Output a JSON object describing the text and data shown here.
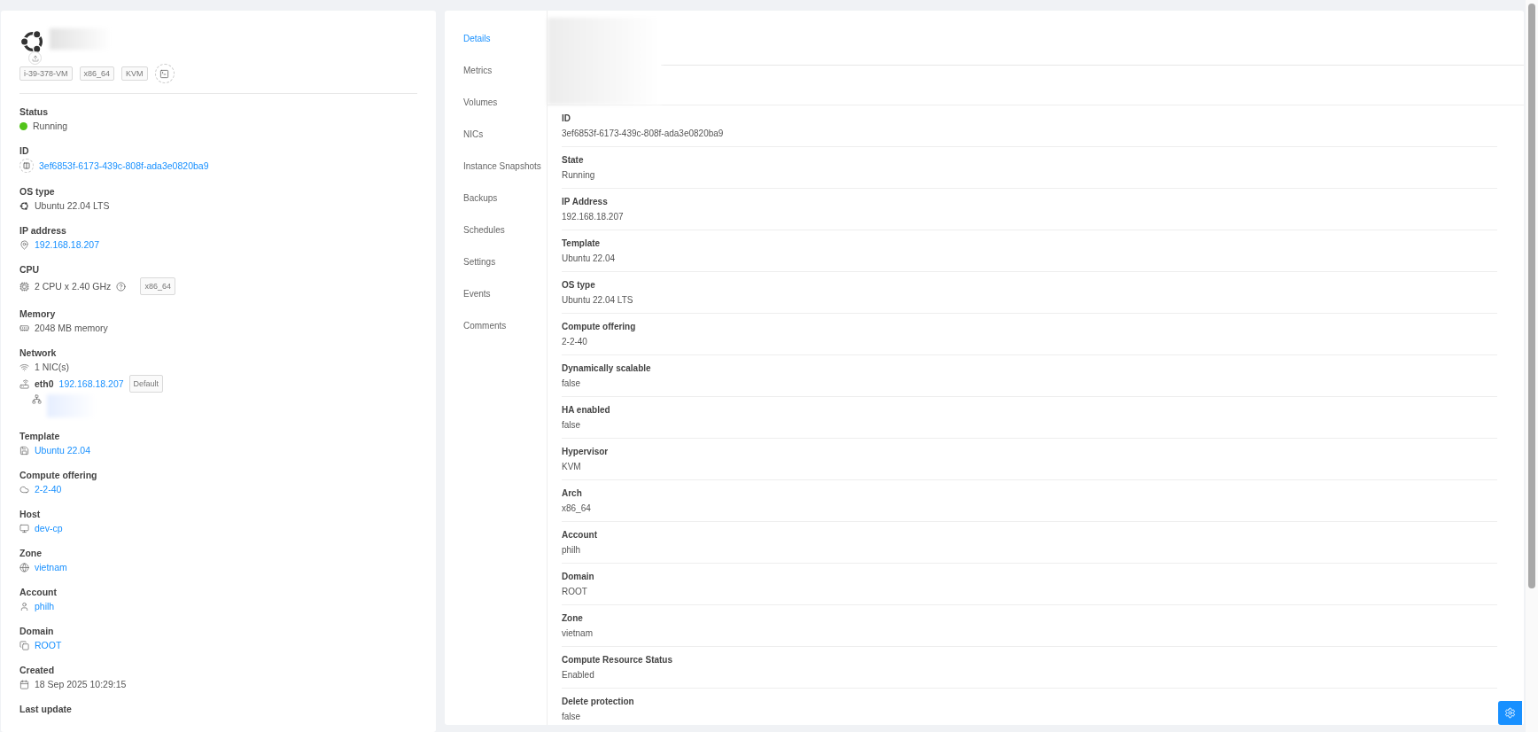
{
  "instance": {
    "tags": [
      "i-39-378-VM",
      "x86_64",
      "KVM"
    ]
  },
  "info": [
    {
      "kind": "status",
      "label": "Status",
      "value": "Running",
      "color": "#52c41a"
    },
    {
      "kind": "link",
      "label": "ID",
      "value": "3ef6853f-6173-439c-808f-ada3e0820ba9"
    },
    {
      "kind": "text",
      "label": "OS type",
      "value": "Ubuntu 22.04 LTS"
    },
    {
      "kind": "link",
      "label": "IP address",
      "value": "192.168.18.207"
    },
    {
      "kind": "cpu",
      "label": "CPU",
      "value": "2 CPU x 2.40 GHz",
      "tag": "x86_64"
    },
    {
      "kind": "text",
      "label": "Memory",
      "value": "2048 MB memory"
    },
    {
      "kind": "network",
      "label": "Network",
      "value": "1 NIC(s)",
      "nics": [
        {
          "name": "eth0",
          "ip": "192.168.18.207",
          "badge": "Default"
        }
      ]
    },
    {
      "kind": "link",
      "label": "Template",
      "value": "Ubuntu 22.04"
    },
    {
      "kind": "link",
      "label": "Compute offering",
      "value": "2-2-40"
    },
    {
      "kind": "link",
      "label": "Host",
      "value": "dev-cp"
    },
    {
      "kind": "link",
      "label": "Zone",
      "value": "vietnam"
    },
    {
      "kind": "link",
      "label": "Account",
      "value": "philh"
    },
    {
      "kind": "link",
      "label": "Domain",
      "value": "ROOT"
    },
    {
      "kind": "text",
      "label": "Created",
      "value": "18 Sep 2025 10:29:15"
    },
    {
      "kind": "heading",
      "label": "Last update"
    }
  ],
  "tabs": [
    {
      "label": "Details",
      "selected": true
    },
    {
      "label": "Metrics",
      "selected": false
    },
    {
      "label": "Volumes",
      "selected": false
    },
    {
      "label": "NICs",
      "selected": false
    },
    {
      "label": "Instance Snapshots",
      "selected": false
    },
    {
      "label": "Backups",
      "selected": false
    },
    {
      "label": "Schedules",
      "selected": false
    },
    {
      "label": "Settings",
      "selected": false
    },
    {
      "label": "Events",
      "selected": false
    },
    {
      "label": "Comments",
      "selected": false
    }
  ],
  "details": [
    {
      "label": "ID",
      "value": "3ef6853f-6173-439c-808f-ada3e0820ba9"
    },
    {
      "label": "State",
      "value": "Running"
    },
    {
      "label": "IP Address",
      "value": "192.168.18.207"
    },
    {
      "label": "Template",
      "value": "Ubuntu 22.04"
    },
    {
      "label": "OS type",
      "value": "Ubuntu 22.04 LTS"
    },
    {
      "label": "Compute offering",
      "value": "2-2-40"
    },
    {
      "label": "Dynamically scalable",
      "value": "false"
    },
    {
      "label": "HA enabled",
      "value": "false"
    },
    {
      "label": "Hypervisor",
      "value": "KVM"
    },
    {
      "label": "Arch",
      "value": "x86_64"
    },
    {
      "label": "Account",
      "value": "philh"
    },
    {
      "label": "Domain",
      "value": "ROOT"
    },
    {
      "label": "Zone",
      "value": "vietnam"
    },
    {
      "label": "Compute Resource Status",
      "value": "Enabled"
    },
    {
      "label": "Delete protection",
      "value": "false"
    }
  ]
}
